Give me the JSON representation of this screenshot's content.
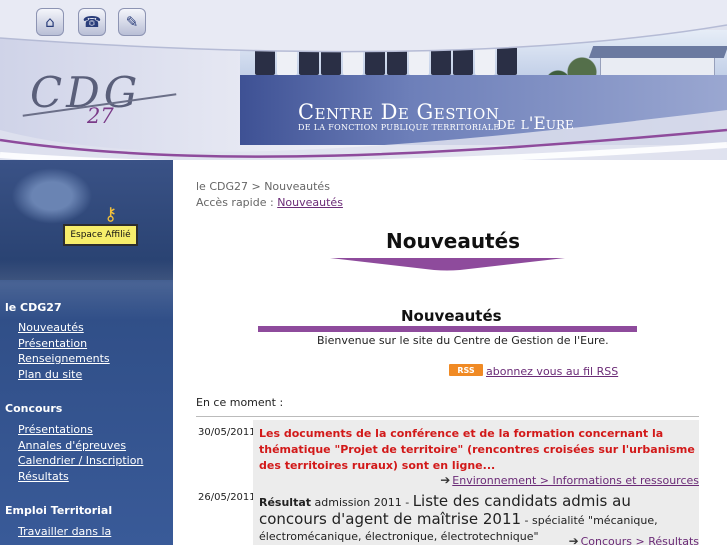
{
  "header": {
    "title_main": "Centre De Gestion",
    "title_sub": "DE LA FONCTION PUBLIQUE TERRITORIALE",
    "title_tail": "de l'Eure",
    "logo_text": "CDG",
    "logo_num": "27",
    "icons": [
      "home-icon",
      "phone-icon",
      "edit-icon"
    ]
  },
  "sidebar": {
    "affilie_label": "Espace Affilié",
    "sections": [
      {
        "title": "le CDG27",
        "items": [
          "Nouveautés",
          "Présentation",
          "Renseignements",
          "Plan du site"
        ]
      },
      {
        "title": "Concours",
        "items": [
          "Présentations",
          "Annales d'épreuves",
          "Calendrier / Inscription",
          "Résultats"
        ]
      },
      {
        "title": "Emploi Territorial",
        "items": [
          "Travailler dans la"
        ]
      }
    ]
  },
  "main": {
    "breadcrumb": "le CDG27 > Nouveautés",
    "quick_label": "Accès rapide : ",
    "quick_link": "Nouveautés",
    "page_title": "Nouveautés",
    "section_title": "Nouveautés",
    "welcome": "Bienvenue sur le site du Centre de Gestion de l'Eure.",
    "rss_badge": "RSS",
    "rss_link": "abonnez vous au fil RSS",
    "moment_label": "En ce moment :",
    "news": [
      {
        "date": "30/05/2011",
        "text": "Les documents de la conférence et de la formation concernant la thématique \"Projet de territoire\" (rencontres croisées sur l'urbanisme des territoires ruraux) sont en ligne...",
        "link": "Environnement > Informations et ressources"
      },
      {
        "date": "26/05/2011",
        "lead": "Résultat",
        "lead_rest": " admission 2011 - ",
        "headline": "Liste des candidats admis au concours d'agent de maîtrise 2011",
        "tail": " - spécialité \"mécanique, électromécanique, électronique, électrotechnique\"",
        "link": "Concours > Résultats"
      }
    ]
  }
}
